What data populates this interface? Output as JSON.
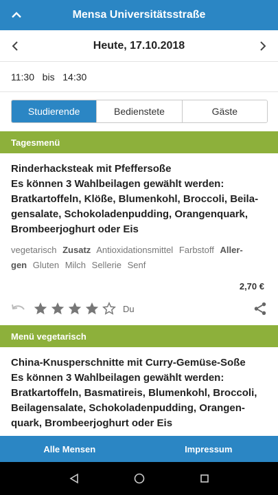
{
  "header": {
    "title": "Mensa Universitätsstraße"
  },
  "date_bar": {
    "date": "Heute, 17.10.2018"
  },
  "hours": {
    "open": "11:30",
    "separator": "bis",
    "close": "14:30"
  },
  "tabs": [
    {
      "label": "Studierende",
      "active": true
    },
    {
      "label": "Bedienstete",
      "active": false
    },
    {
      "label": "Gäste",
      "active": false
    }
  ],
  "meals": [
    {
      "section": "Tagesmenü",
      "lines": [
        "Rinderhacksteak mit Pfeffersoße",
        "Es können 3 Wahlbeilagen gewählt werden:",
        "Bratkartoffeln, Klöße, Blumenkohl, Broccoli, Beila-",
        "gensalate, Schokoladenpudding, Orangenquark,",
        "Brombeerjoghurt oder Eis"
      ],
      "tags_line1": {
        "diet": "vegetarisch",
        "zusatz_label": "Zusatz",
        "zusatz1": "Antioxidationsmittel",
        "zusatz2": "Farbstoff",
        "allergen_label_part1": "Aller-"
      },
      "tags_line2": {
        "allergen_label_part2": "gen",
        "allergens": [
          "Gluten",
          "Milch",
          "Sellerie",
          "Senf"
        ]
      },
      "price": "2,70 €",
      "rating": {
        "stars": 4,
        "max": 5,
        "user_label": "Du"
      }
    },
    {
      "section": "Menü vegetarisch",
      "lines": [
        "China-Knusperschnitte mit Curry-Gemüse-Soße",
        "Es können 3 Wahlbeilagen gewählt werden:",
        "Bratkartoffeln, Basmatireis, Blumenkohl, Broccoli,",
        "Beilagensalate, Schokoladenpudding, Orangen-",
        "quark, Brombeerjoghurt oder Eis"
      ]
    }
  ],
  "bottom_nav": {
    "left": "Alle Mensen",
    "right": "Impressum"
  },
  "icons": {
    "collapse": "chevron-up-icon",
    "prev": "chevron-left-icon",
    "next": "chevron-right-icon",
    "undo": "undo-icon",
    "star": "star-icon",
    "share": "share-icon",
    "back": "triangle-back-icon",
    "home": "circle-home-icon",
    "recents": "square-recents-icon"
  },
  "colors": {
    "primary": "#2b86c4",
    "section": "#8db03b",
    "star": "#777777"
  }
}
